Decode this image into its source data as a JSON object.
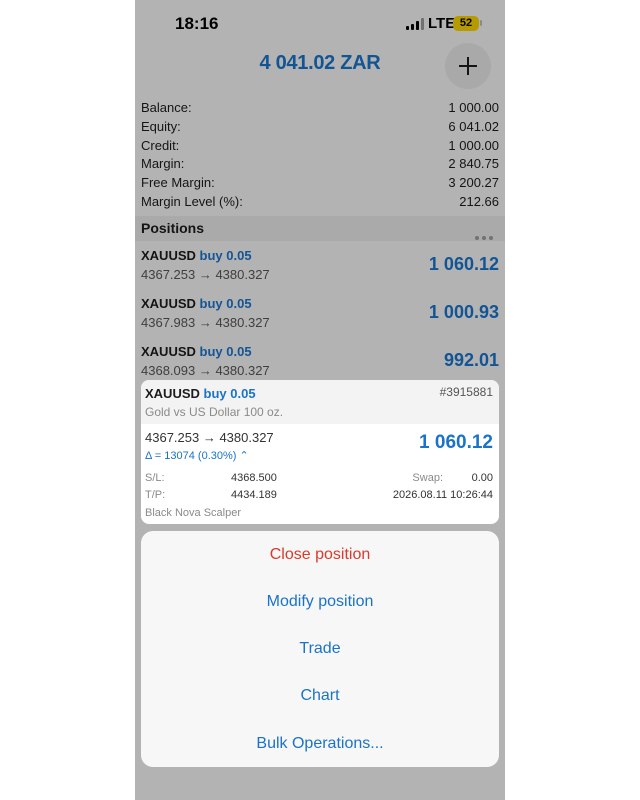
{
  "status_bar": {
    "time": "18:16",
    "network": "LTE",
    "battery": "52"
  },
  "header": {
    "title": "4 041.02 ZAR"
  },
  "account": [
    {
      "label": "Balance:",
      "value": "1 000.00"
    },
    {
      "label": "Equity:",
      "value": "6 041.02"
    },
    {
      "label": "Credit:",
      "value": "1 000.00"
    },
    {
      "label": "Margin:",
      "value": "2 840.75"
    },
    {
      "label": "Free Margin:",
      "value": "3 200.27"
    },
    {
      "label": "Margin Level (%):",
      "value": "212.66"
    }
  ],
  "positions": {
    "title": "Positions",
    "rows": [
      {
        "symbol": "XAUUSD",
        "side": "buy 0.05",
        "prices": "4367.253 → 4380.327",
        "profit": "1 060.12"
      },
      {
        "symbol": "XAUUSD",
        "side": "buy 0.05",
        "prices": "4367.983 → 4380.327",
        "profit": "1 000.93"
      },
      {
        "symbol": "XAUUSD",
        "side": "buy 0.05",
        "prices": "4368.093 → 4380.327",
        "profit": "992.01"
      }
    ]
  },
  "detail": {
    "symbol": "XAUUSD",
    "side": "buy 0.05",
    "ticket": "#3915881",
    "description": "Gold vs US Dollar 100 oz.",
    "prices": "4367.253 → 4380.327",
    "profit": "1 060.12",
    "delta": "Δ = 13074 (0.30%) ⌃",
    "sl_label": "S/L:",
    "sl_value": "4368.500",
    "swap_label": "Swap:",
    "swap_value": "0.00",
    "tp_label": "T/P:",
    "tp_value": "4434.189",
    "time": "2026.08.11 10:26:44",
    "comment": "Black Nova Scalper"
  },
  "actions": [
    {
      "label": "Close position"
    },
    {
      "label": "Modify position"
    },
    {
      "label": "Trade"
    },
    {
      "label": "Chart"
    },
    {
      "label": "Bulk Operations..."
    }
  ],
  "colors": {
    "accent": "#1a73c8",
    "danger": "#d93a2b",
    "battery": "#f4d000"
  },
  "icons": [
    "plus-icon",
    "more-dots-icon",
    "signal-icon",
    "battery-icon"
  ]
}
